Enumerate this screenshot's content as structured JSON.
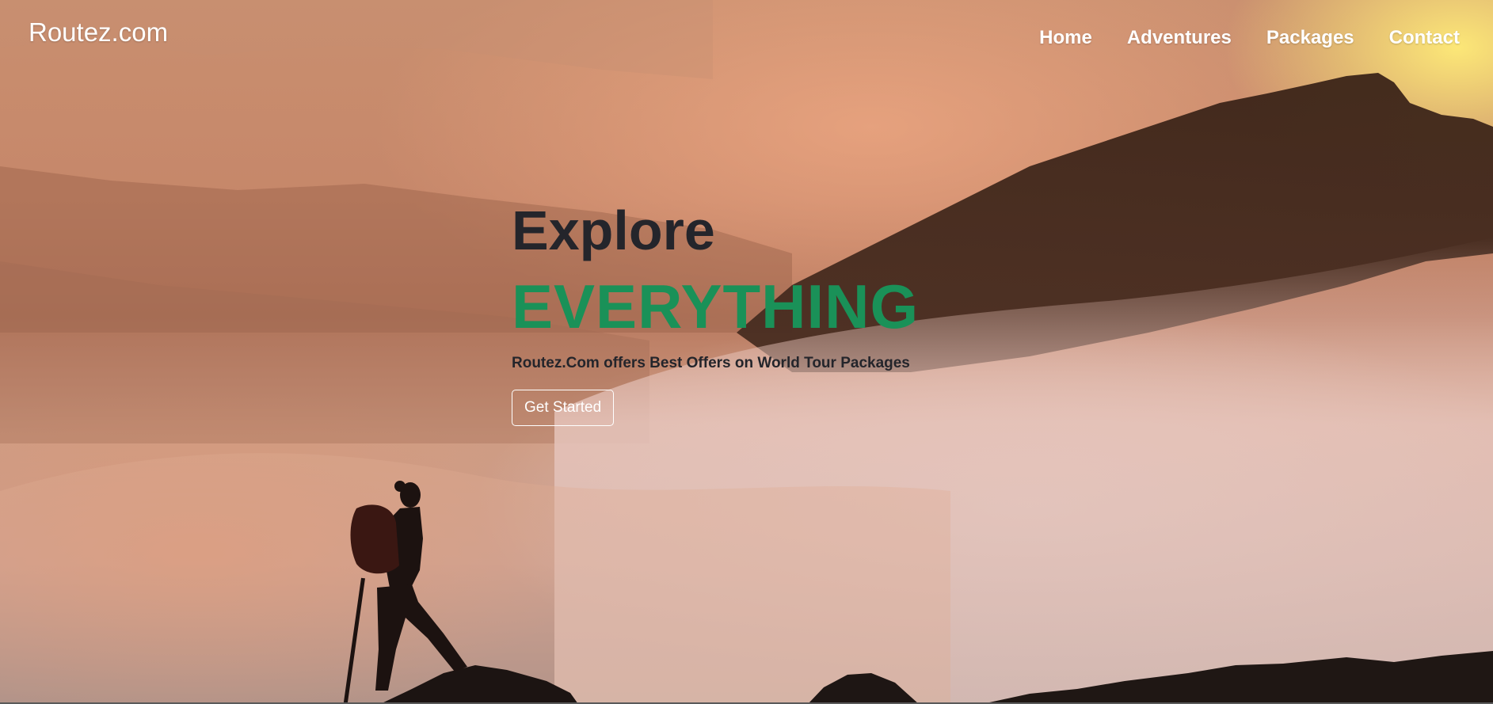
{
  "nav": {
    "brand": "Routez.com",
    "links": [
      "Home",
      "Adventures",
      "Packages",
      "Contact"
    ]
  },
  "hero": {
    "title": "Explore",
    "highlight": "EVERYTHING",
    "subtitle": "Routez.Com offers Best Offers on World Tour Packages",
    "cta_label": "Get Started"
  },
  "colors": {
    "highlight": "#1a9158",
    "title_text": "#24252b",
    "nav_text": "#ffffff"
  },
  "icons": {
    "background": "mountain-hiker-background-image"
  }
}
